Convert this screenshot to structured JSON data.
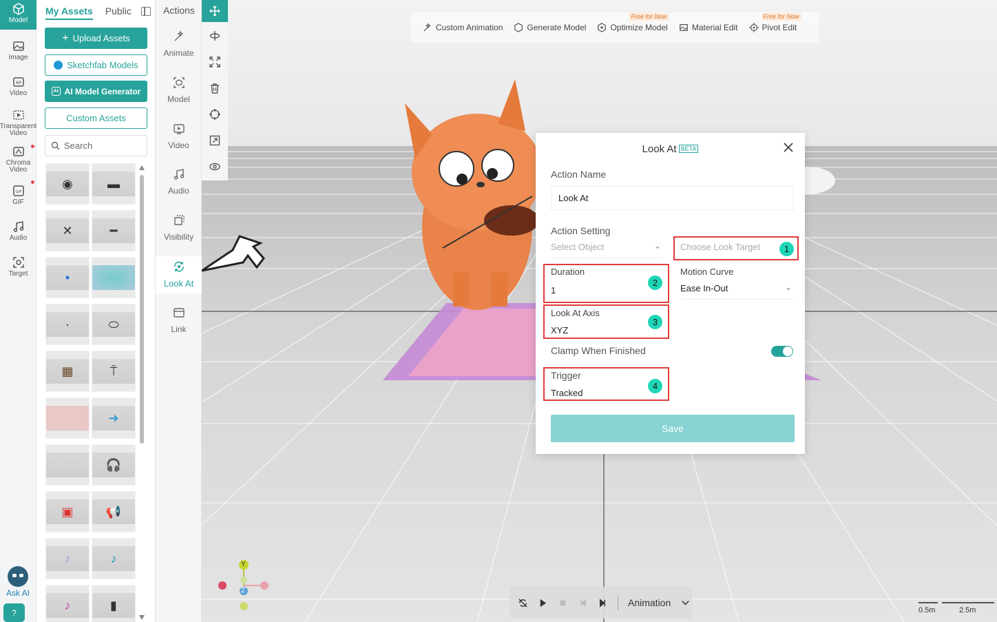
{
  "rail": {
    "items": [
      {
        "label": "Model",
        "icon": "cube-icon"
      },
      {
        "label": "Image",
        "icon": "image-icon"
      },
      {
        "label": "Video",
        "icon": "ar-video-icon"
      },
      {
        "label": "Transparent Video",
        "icon": "transparent-video-icon"
      },
      {
        "label": "Chroma Video",
        "icon": "chroma-video-icon"
      },
      {
        "label": "GIF",
        "icon": "gif-icon"
      },
      {
        "label": "Audio",
        "icon": "music-icon"
      },
      {
        "label": "Target",
        "icon": "target-icon"
      }
    ],
    "ask_ai": "Ask AI"
  },
  "assets": {
    "tab_my": "My Assets",
    "tab_public": "Public",
    "upload": "Upload Assets",
    "sketchfab": "Sketchfab Models",
    "ai_generator": "AI Model Generator",
    "custom": "Custom Assets",
    "search_placeholder": "Search"
  },
  "actions": {
    "title": "Actions",
    "items": [
      "Animate",
      "Model",
      "Video",
      "Audio",
      "Visibility",
      "Look At",
      "Link"
    ]
  },
  "toolbar": {
    "custom_animation": "Custom Animation",
    "generate_model": "Generate Model",
    "optimize_model": "Optimize Model",
    "material_edit": "Material Edit",
    "pivot_edit": "Pivot Edit",
    "free_badge": "Free for Now"
  },
  "dialog": {
    "title": "Look At",
    "beta": "BETA",
    "action_name_label": "Action Name",
    "action_name_value": "Look At",
    "action_setting_label": "Action Setting",
    "select_object": "Select Object",
    "choose_look_target": "Choose Look Target",
    "duration_label": "Duration",
    "duration_value": "1",
    "motion_curve_label": "Motion Curve",
    "motion_curve_value": "Ease In-Out",
    "look_at_axis_label": "Look At Axis",
    "look_at_axis_value": "XYZ",
    "clamp_label": "Clamp When Finished",
    "clamp_on": true,
    "trigger_label": "Trigger",
    "trigger_value": "Tracked",
    "save": "Save",
    "markers": [
      "1",
      "2",
      "3",
      "4"
    ]
  },
  "playbar": {
    "mode": "Animation"
  },
  "gizmo": {
    "y": "Y",
    "z": "Z"
  },
  "scale": {
    "small": "0.5m",
    "large": "2.5m"
  },
  "colors": {
    "accent": "#27a39b",
    "marker": "#1fd6b7",
    "highlight": "#e23b3b",
    "save": "#86d3d2"
  }
}
